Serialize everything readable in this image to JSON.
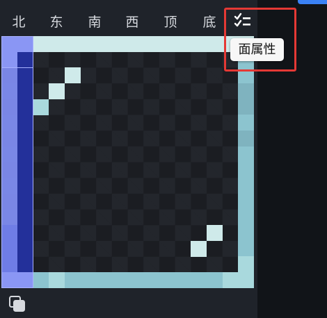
{
  "tabs": [
    {
      "id": "north",
      "label": "北"
    },
    {
      "id": "east",
      "label": "东"
    },
    {
      "id": "south",
      "label": "南"
    },
    {
      "id": "west",
      "label": "西"
    },
    {
      "id": "top",
      "label": "顶"
    },
    {
      "id": "bottom",
      "label": "底"
    }
  ],
  "face_properties": {
    "icon": "checklist-icon",
    "tooltip": "面属性"
  },
  "toolbar": {
    "copy_icon": "copy-icon"
  },
  "colors": {
    "accent": "#3b82f6",
    "highlight": "#e53935",
    "texture_light": "#cfeaea",
    "texture_mid": "#8cc4cf",
    "uv_selection": "#7f8cf0",
    "uv_selection_dark": "#23309a"
  }
}
